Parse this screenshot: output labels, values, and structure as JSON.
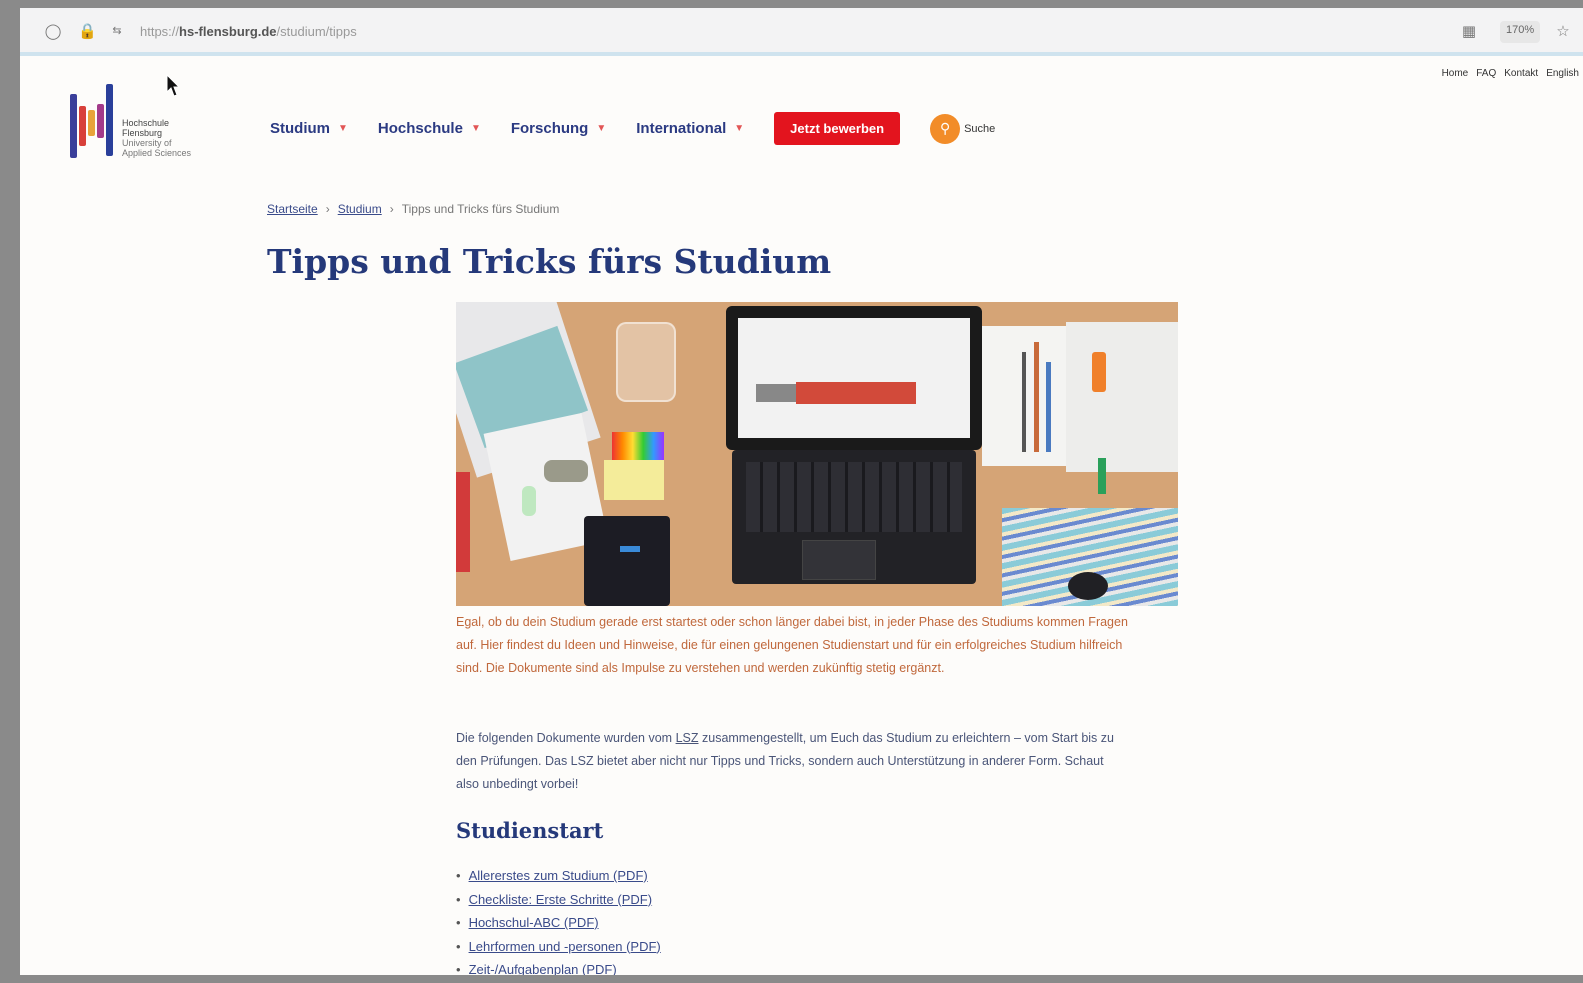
{
  "browser": {
    "url_prefix": "https://",
    "url_domain": "hs-flensburg.de",
    "url_path": "/studium/tipps",
    "zoom": "170%"
  },
  "header": {
    "top_links": [
      "Home",
      "FAQ",
      "Kontakt",
      "English"
    ],
    "logo": {
      "line1": "Hochschule",
      "line2": "Flensburg",
      "line3": "University of",
      "line4": "Applied Sciences"
    },
    "nav": [
      {
        "label": "Studium"
      },
      {
        "label": "Hochschule"
      },
      {
        "label": "Forschung"
      },
      {
        "label": "International"
      }
    ],
    "apply_label": "Jetzt bewerben",
    "search_label": "Suche"
  },
  "breadcrumb": {
    "home": "Startseite",
    "parent": "Studium",
    "current": "Tipps und Tricks fürs Studium",
    "separator": "›"
  },
  "page": {
    "title": "Tipps und Tricks fürs Studium",
    "intro": "Egal, ob du dein Studium gerade erst startest oder schon länger dabei bist, in jeder Phase des Studiums kommen Fragen auf. Hier findest du Ideen und Hinweise, die für einen gelungenen Studienstart und für ein erfolgreiches Studium hilfreich sind. Die Dokumente sind als Impulse zu verstehen und werden zukünftig stetig ergänzt.",
    "body_before_link": "Die folgenden Dokumente wurden vom ",
    "body_link": "LSZ",
    "body_after_link": " zusammengestellt, um Euch das Studium zu erleichtern – vom Start bis zu den Prüfungen. Das LSZ bietet aber nicht nur Tipps und Tricks, sondern auch Unterstützung in anderer Form. Schaut also unbedingt vorbei!",
    "section_title": "Studienstart",
    "documents": [
      "Allererstes zum Studium (PDF)",
      "Checkliste: Erste Schritte (PDF)",
      "Hochschul-ABC (PDF)",
      "Lehrformen und -personen (PDF)",
      "Zeit-/Aufgabenplan (PDF)"
    ]
  },
  "icons": {
    "shield": "shield-icon",
    "lock": "lock-icon",
    "permissions": "permissions-icon",
    "reader": "reader-icon",
    "star": "star-icon",
    "search": "search-icon"
  },
  "colors": {
    "brand_blue": "#25397a",
    "apply_red": "#e3141e",
    "search_orange": "#f28c28",
    "intro_text": "#c0683c"
  }
}
